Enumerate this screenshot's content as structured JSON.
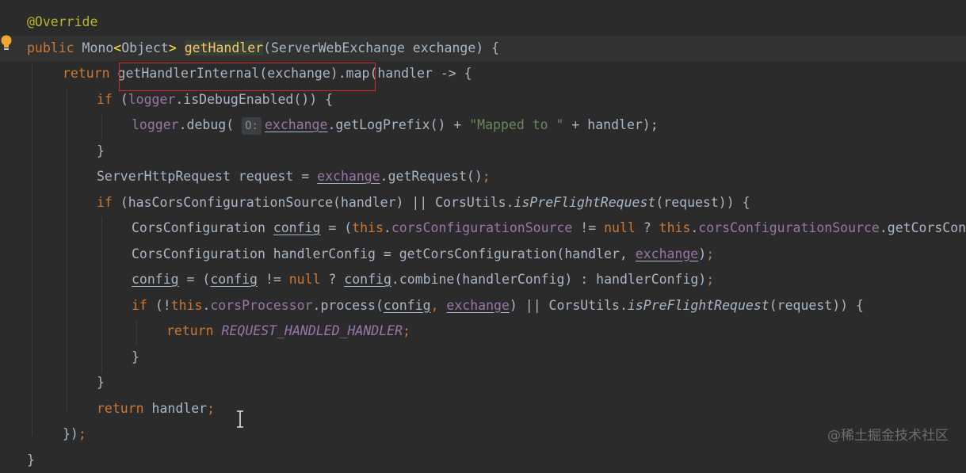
{
  "editor": {
    "lines": [
      {
        "id": "l1",
        "parts": [
          {
            "t": "@Override",
            "c": "ann"
          }
        ]
      },
      {
        "id": "l2",
        "parts": [
          {
            "t": "public ",
            "c": "kw"
          },
          {
            "t": "Mono"
          },
          {
            "t": "<",
            "c": "brace-match"
          },
          {
            "t": "Object"
          },
          {
            "t": ">",
            "c": "brace-match"
          },
          {
            "t": " "
          },
          {
            "t": "getHandler",
            "c": "fn fn-hl"
          },
          {
            "t": "(ServerWebExchange exchange) {"
          }
        ]
      },
      {
        "id": "l3",
        "parts": [
          {
            "t": "return ",
            "c": "kw"
          },
          {
            "t": "getHandlerInternal(exchange)"
          },
          {
            "t": ".map(handler -> {"
          }
        ]
      },
      {
        "id": "l4",
        "parts": [
          {
            "t": "if ",
            "c": "kw"
          },
          {
            "t": "("
          },
          {
            "t": "logger",
            "c": "fld"
          },
          {
            "t": ".isDebugEnabled()) {"
          }
        ]
      },
      {
        "id": "l5",
        "parts": [
          {
            "t": "logger",
            "c": "fld"
          },
          {
            "t": ".debug( "
          },
          {
            "t": "O:",
            "c": "hint"
          },
          {
            "t": "exchange",
            "c": "fld ul"
          },
          {
            "t": ".getLogPrefix() + "
          },
          {
            "t": "\"Mapped to \"",
            "c": "str"
          },
          {
            "t": " + handler);"
          }
        ]
      },
      {
        "id": "l6",
        "parts": [
          {
            "t": "}"
          }
        ]
      },
      {
        "id": "l7",
        "parts": [
          {
            "t": "ServerHttpRequest request = "
          },
          {
            "t": "exchange",
            "c": "fld ul"
          },
          {
            "t": ".getRequest()"
          },
          {
            "t": ";",
            "c": "kw"
          }
        ]
      },
      {
        "id": "l8",
        "parts": [
          {
            "t": "if ",
            "c": "kw"
          },
          {
            "t": "(hasCorsConfigurationSource(handler) || CorsUtils."
          },
          {
            "t": "isPreFlightRequest",
            "c": "ital"
          },
          {
            "t": "(request)) {"
          }
        ]
      },
      {
        "id": "l9",
        "parts": [
          {
            "t": "CorsConfiguration "
          },
          {
            "t": "config",
            "c": "ul"
          },
          {
            "t": " = ("
          },
          {
            "t": "this",
            "c": "kw"
          },
          {
            "t": "."
          },
          {
            "t": "corsConfigurationSource",
            "c": "fld"
          },
          {
            "t": " != "
          },
          {
            "t": "null",
            "c": "kw"
          },
          {
            "t": " ? "
          },
          {
            "t": "this",
            "c": "kw"
          },
          {
            "t": "."
          },
          {
            "t": "corsConfigurationSource",
            "c": "fld"
          },
          {
            "t": ".getCorsConfiguration(exchange) : null);"
          }
        ]
      },
      {
        "id": "l10",
        "parts": [
          {
            "t": "CorsConfiguration handlerConfig = getCorsConfiguration(handler, "
          },
          {
            "t": "exchange",
            "c": "fld ul"
          },
          {
            "t": ")"
          },
          {
            "t": ";",
            "c": "kw"
          }
        ]
      },
      {
        "id": "l11",
        "parts": [
          {
            "t": "config",
            "c": "ul"
          },
          {
            "t": " = ("
          },
          {
            "t": "config",
            "c": "ul"
          },
          {
            "t": " != "
          },
          {
            "t": "null",
            "c": "kw"
          },
          {
            "t": " ? "
          },
          {
            "t": "config",
            "c": "ul"
          },
          {
            "t": ".combine(handlerConfig) : handlerConfig)"
          },
          {
            "t": ";",
            "c": "kw"
          }
        ]
      },
      {
        "id": "l12",
        "parts": [
          {
            "t": "if ",
            "c": "kw"
          },
          {
            "t": "(!"
          },
          {
            "t": "this",
            "c": "kw"
          },
          {
            "t": "."
          },
          {
            "t": "corsProcessor",
            "c": "fld"
          },
          {
            "t": ".process("
          },
          {
            "t": "config",
            "c": "ul"
          },
          {
            "t": ", ",
            "c": "kw"
          },
          {
            "t": "exchange",
            "c": "fld ul"
          },
          {
            "t": ") || CorsUtils."
          },
          {
            "t": "isPreFlightRequest",
            "c": "ital"
          },
          {
            "t": "(request)) {"
          }
        ]
      },
      {
        "id": "l13",
        "parts": [
          {
            "t": "return ",
            "c": "kw"
          },
          {
            "t": "REQUEST_HANDLED_HANDLER",
            "c": "cst"
          },
          {
            "t": ";",
            "c": "kw"
          }
        ]
      },
      {
        "id": "l14",
        "parts": [
          {
            "t": "}"
          }
        ]
      },
      {
        "id": "l15",
        "parts": [
          {
            "t": "}"
          }
        ]
      },
      {
        "id": "l16",
        "parts": [
          {
            "t": "return ",
            "c": "kw"
          },
          {
            "t": "handler"
          },
          {
            "t": ";",
            "c": "kw"
          }
        ]
      },
      {
        "id": "l17",
        "parts": [
          {
            "t": "})"
          },
          {
            "t": ";",
            "c": "kw"
          }
        ]
      },
      {
        "id": "l18",
        "parts": [
          {
            "t": "}"
          }
        ]
      }
    ]
  },
  "overlay": {
    "highlight_box_label": "getHandlerInternal(exchange)",
    "watermark": "@稀土掘金技术社区"
  },
  "icons": {
    "intention_bulb": "lightbulb-icon",
    "text_cursor": "i-beam-cursor-icon"
  },
  "colors": {
    "background": "#2b2b2b",
    "keyword": "#cc7832",
    "annotation": "#bbb529",
    "method": "#ffc66d",
    "string": "#6a8759",
    "field": "#9876aa",
    "text": "#a9b7c6",
    "highlight_box": "#d42a2a"
  }
}
